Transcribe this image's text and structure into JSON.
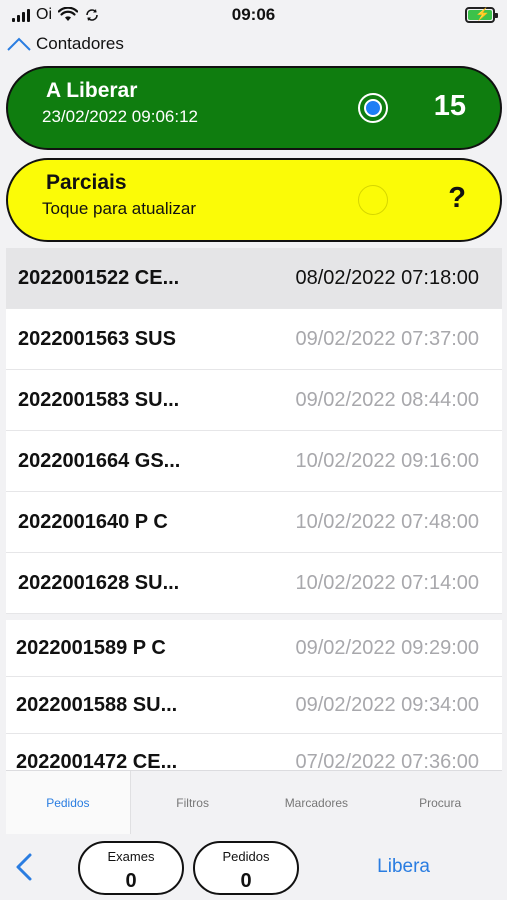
{
  "status_bar": {
    "carrier": "Oi",
    "time": "09:06",
    "icons": [
      "signal-icon",
      "wifi-icon",
      "sync-icon",
      "battery-charging-icon"
    ]
  },
  "header": {
    "back_label": "Contadores"
  },
  "counters": {
    "liberar": {
      "title": "A Liberar",
      "subtitle": "23/02/2022 09:06:12",
      "count": "15",
      "color": "#0f7d0f",
      "selected": true
    },
    "parciais": {
      "title": "Parciais",
      "subtitle": "Toque para atualizar",
      "count": "?",
      "color": "#fbfb07",
      "selected": false
    }
  },
  "orders": [
    {
      "code": "2022001522 CE...",
      "date": "08/02/2022 07:18:00"
    },
    {
      "code": "2022001563 SUS",
      "date": "09/02/2022 07:37:00"
    },
    {
      "code": "2022001583 SU...",
      "date": "09/02/2022 08:44:00"
    },
    {
      "code": "2022001664 GS...",
      "date": "10/02/2022 09:16:00"
    },
    {
      "code": "2022001640 P C",
      "date": "10/02/2022 07:48:00"
    },
    {
      "code": "2022001628 SU...",
      "date": "10/02/2022 07:14:00"
    }
  ],
  "orders2": [
    {
      "code": "2022001589 P C",
      "date": "09/02/2022 09:29:00"
    },
    {
      "code": "2022001588 SU...",
      "date": "09/02/2022 09:34:00"
    },
    {
      "code": "2022001472 CE...",
      "date": "07/02/2022 07:36:00"
    }
  ],
  "tabs": [
    {
      "label": "Pedidos",
      "active": true
    },
    {
      "label": "Filtros",
      "active": false
    },
    {
      "label": "Marcadores",
      "active": false
    },
    {
      "label": "Procura",
      "active": false
    }
  ],
  "toolbar": {
    "exames_label": "Exames",
    "exames_value": "0",
    "pedidos_label": "Pedidos",
    "pedidos_value": "0",
    "libera_label": "Libera",
    "accent_color": "#2a7de1"
  }
}
